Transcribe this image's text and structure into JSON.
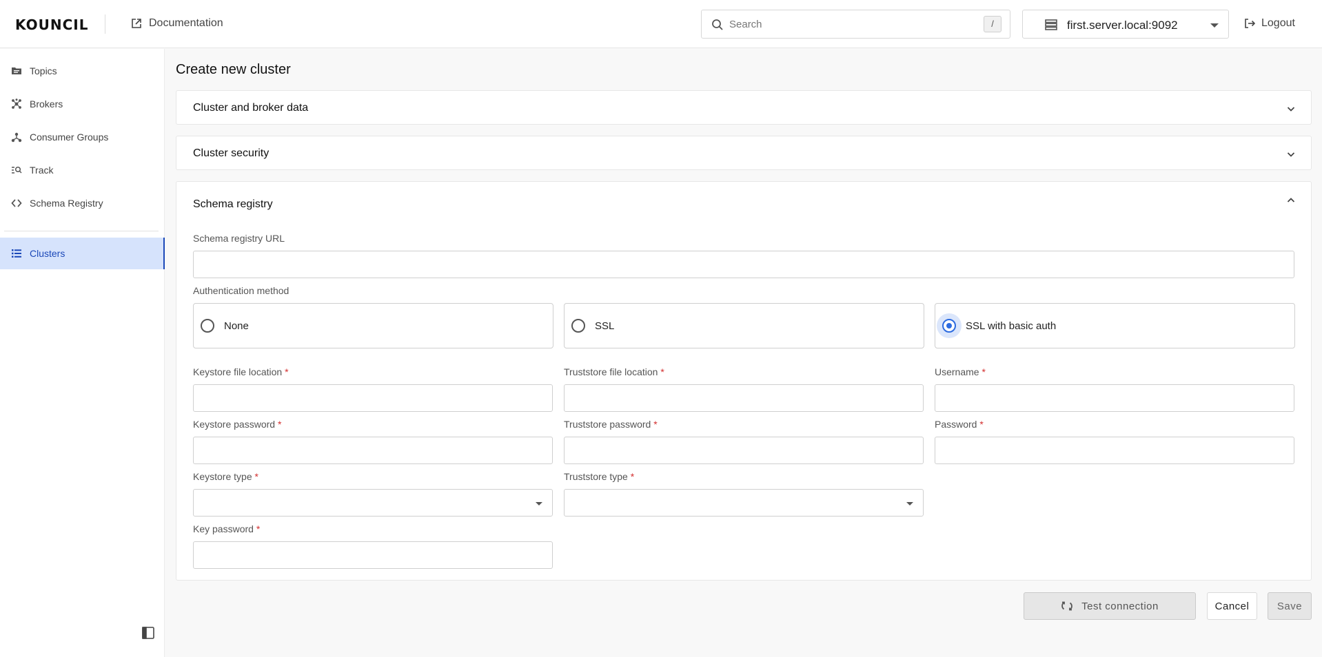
{
  "header": {
    "logo": "KOUNCIL",
    "docs_label": "Documentation",
    "search_placeholder": "Search",
    "search_shortcut": "/",
    "server_label": "first.server.local:9092",
    "logout_label": "Logout"
  },
  "sidebar": {
    "items": [
      {
        "label": "Topics",
        "icon": "folder-icon"
      },
      {
        "label": "Brokers",
        "icon": "brokers-icon"
      },
      {
        "label": "Consumer Groups",
        "icon": "consumer-groups-icon"
      },
      {
        "label": "Track",
        "icon": "track-icon"
      },
      {
        "label": "Schema Registry",
        "icon": "code-icon"
      },
      {
        "label": "Clusters",
        "icon": "list-icon",
        "active": true
      }
    ]
  },
  "main": {
    "title": "Create new cluster",
    "sections": [
      {
        "title": "Cluster and broker data",
        "expanded": false
      },
      {
        "title": "Cluster security",
        "expanded": false
      },
      {
        "title": "Schema registry",
        "expanded": true
      }
    ],
    "schema": {
      "url_label": "Schema registry URL",
      "auth_label": "Authentication method",
      "auth_options": [
        "None",
        "SSL",
        "SSL with basic auth"
      ],
      "auth_selected": "SSL with basic auth",
      "keystore_file_label": "Keystore file location",
      "truststore_file_label": "Truststore file location",
      "username_label": "Username",
      "keystore_password_label": "Keystore password",
      "truststore_password_label": "Truststore password",
      "password_label": "Password",
      "keystore_type_label": "Keystore type",
      "truststore_type_label": "Truststore type",
      "key_password_label": "Key password",
      "required_mark": "*"
    }
  },
  "actions": {
    "test_label": "Test connection",
    "cancel_label": "Cancel",
    "save_label": "Save"
  },
  "colors": {
    "accent": "#2c6be0",
    "sidebar_active_bg": "#d6e3fc",
    "sidebar_active_text": "#1a47b8",
    "required": "#d32f2f"
  }
}
